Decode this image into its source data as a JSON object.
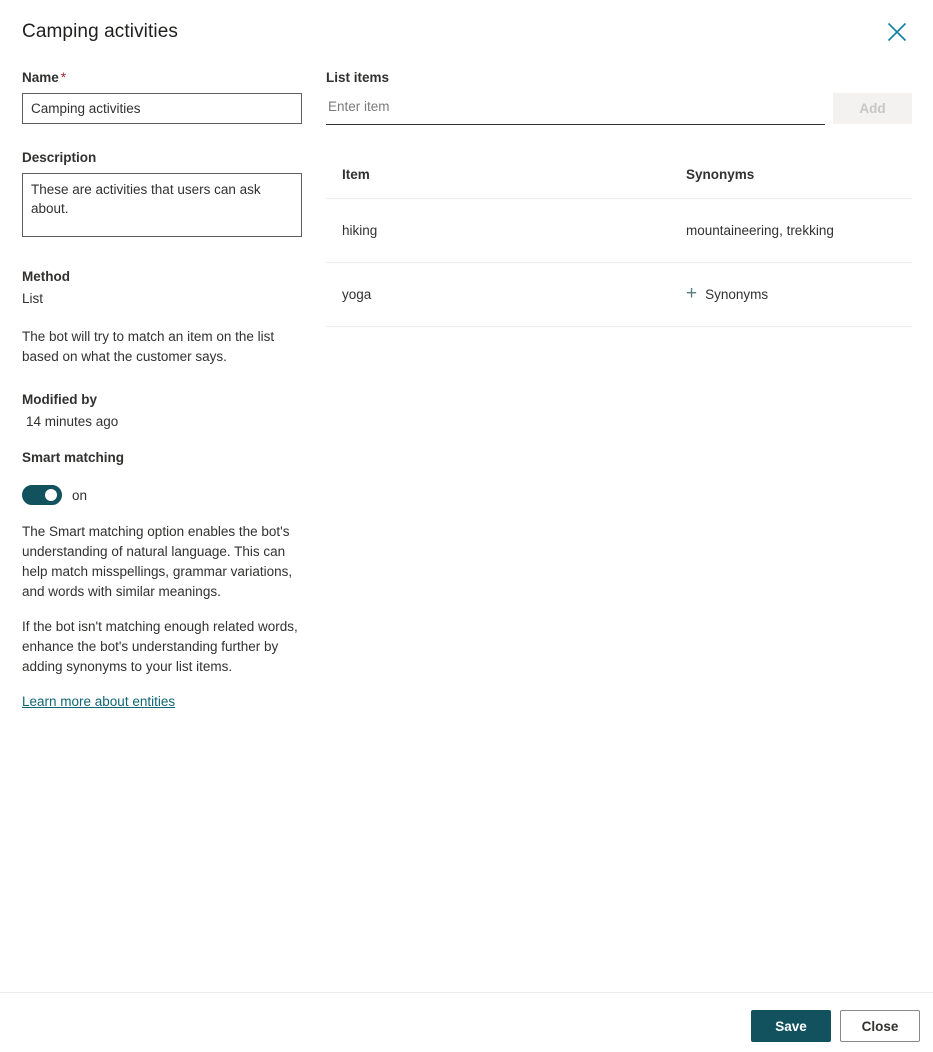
{
  "header": {
    "title": "Camping activities",
    "close_icon": "close-icon"
  },
  "left": {
    "name": {
      "label": "Name",
      "required_marker": "*",
      "value": "Camping activities",
      "placeholder": ""
    },
    "description": {
      "label": "Description",
      "value": "These are activities that users can ask about.",
      "placeholder": ""
    },
    "method": {
      "label": "Method",
      "value": "List",
      "help": "The bot will try to match an item on the list based on what the customer says."
    },
    "modified": {
      "label": "Modified by",
      "value": "14 minutes ago"
    },
    "smart_matching": {
      "label": "Smart matching",
      "toggle_state": "on",
      "paragraph_1": "The Smart matching option enables the bot's understanding of natural language. This can help match misspellings, grammar variations, and words with similar meanings.",
      "paragraph_2": "If the bot isn't matching enough related words, enhance the bot's understanding further by adding synonyms to your list items.",
      "link_label": "Learn more about entities"
    }
  },
  "right": {
    "list_items": {
      "label": "List items",
      "input_value": "",
      "input_placeholder": "Enter item",
      "add_button_label": "Add"
    },
    "table": {
      "columns": [
        "Item",
        "Synonyms"
      ],
      "rows": [
        {
          "item": "hiking",
          "synonyms": "mountaineering, trekking",
          "has_synonyms": true,
          "add_label": ""
        },
        {
          "item": "yoga",
          "synonyms": "",
          "has_synonyms": false,
          "add_label": "Synonyms"
        }
      ]
    }
  },
  "footer": {
    "save_label": "Save",
    "close_label": "Close"
  },
  "colors": {
    "accent_teal": "#12525e",
    "link_teal": "#0f6674",
    "close_icon_blue": "#0f7fa8",
    "required_red": "#a4262c",
    "plus_icon": "#5a7d84",
    "disabled_bg": "#f3f2f1",
    "disabled_text": "#c8c6c4",
    "divider": "#ebebeb"
  }
}
